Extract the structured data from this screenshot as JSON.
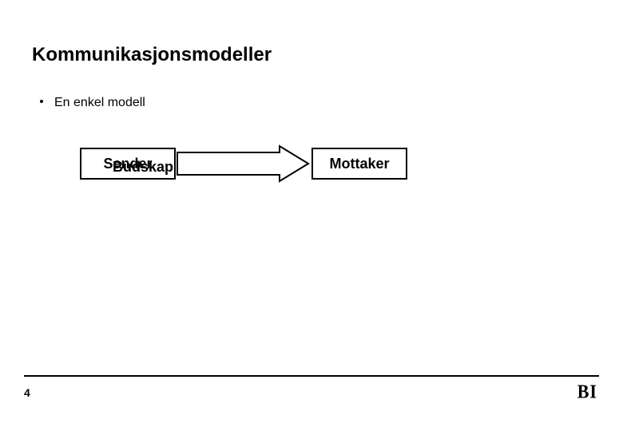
{
  "title": "Kommunikasjonsmodeller",
  "bullet": "En enkel modell",
  "diagram": {
    "sender": "Sender",
    "message": "Budskap",
    "receiver": "Mottaker"
  },
  "footer": {
    "page_number": "4",
    "logo_text": "BI"
  }
}
